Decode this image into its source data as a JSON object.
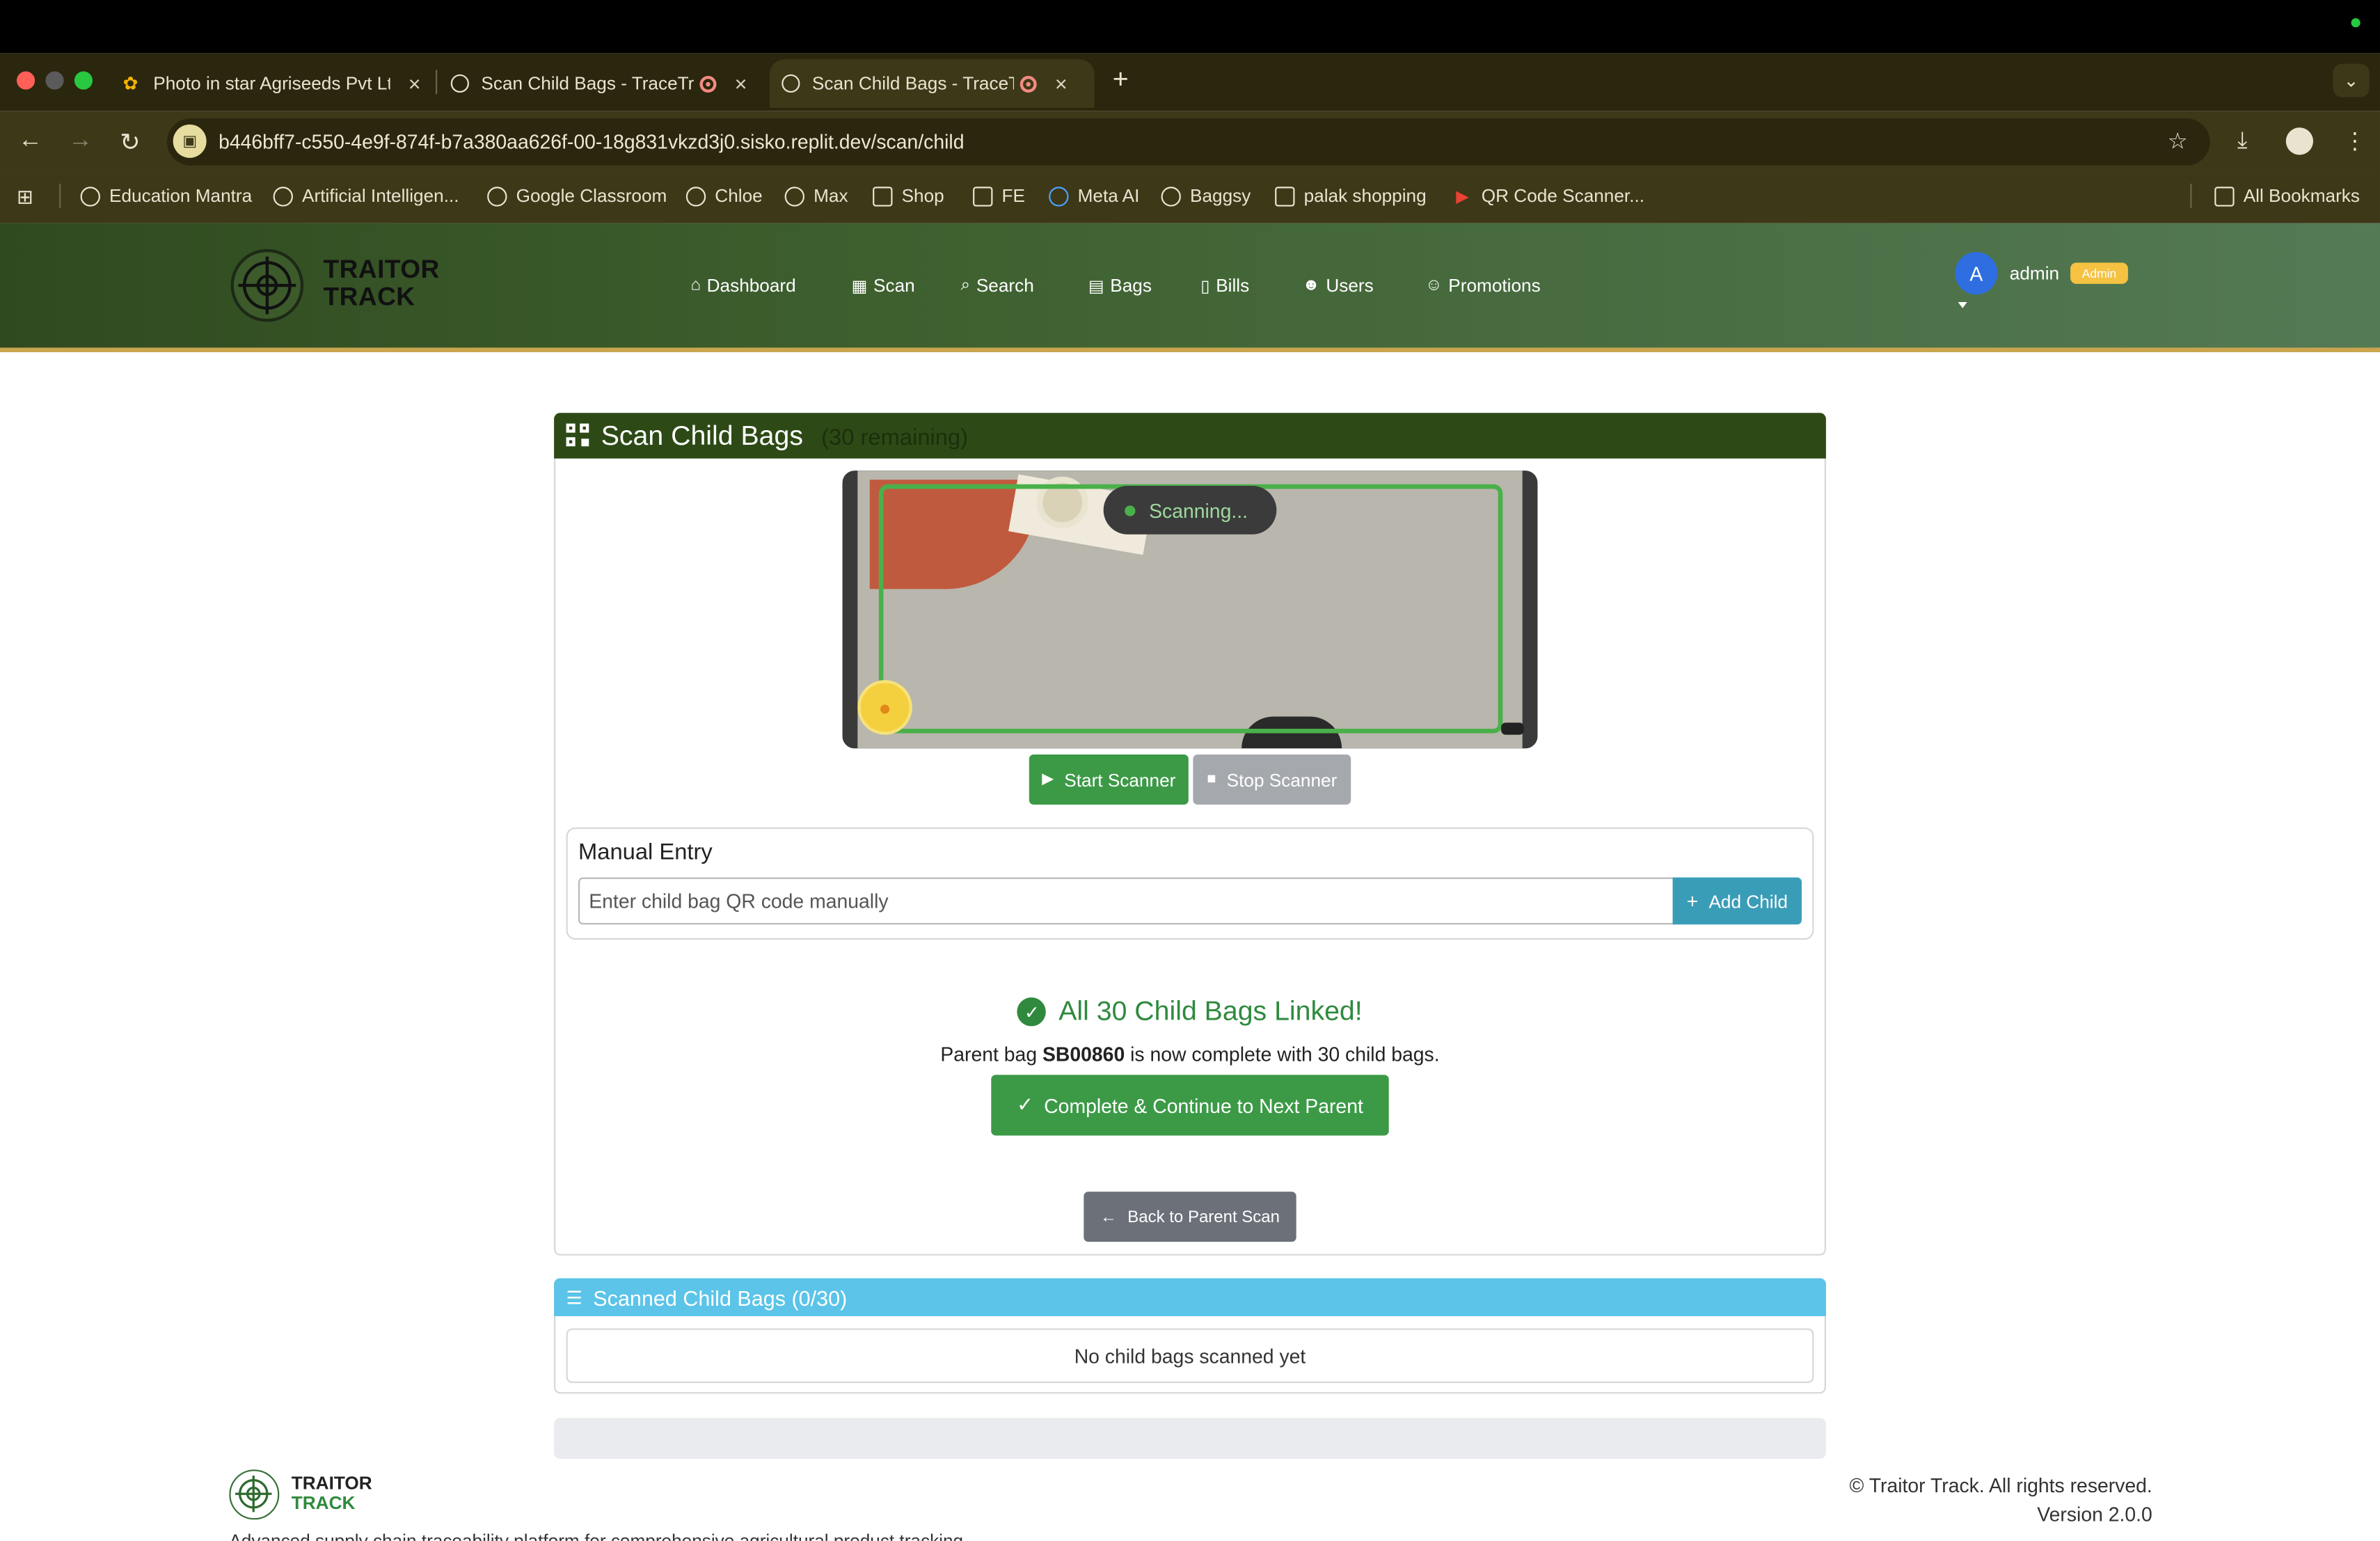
{
  "browser": {
    "tabs": [
      {
        "title": "Photo in star Agriseeds Pvt Ltd",
        "close": "×"
      },
      {
        "title": "Scan Child Bags - TraceTrack",
        "close": "×"
      },
      {
        "title": "Scan Child Bags - TraceTrack",
        "close": "×"
      }
    ],
    "new_tab": "+",
    "url": "b446bff7-c550-4e9f-874f-b7a380aa626f-00-18g831vkzd3j0.sisko.replit.dev/scan/child",
    "bookmarks": [
      "Education Mantra",
      "Artificial Intelligen...",
      "Google Classroom",
      "Chloe",
      "Max",
      "Shop",
      "FE",
      "Meta AI",
      "Baggsy",
      "palak shopping",
      "QR Code Scanner..."
    ],
    "all_bookmarks": "All Bookmarks"
  },
  "app": {
    "logo_line1": "TRAITOR",
    "logo_line2": "TRACK",
    "nav": [
      "Dashboard",
      "Scan",
      "Search",
      "Bags",
      "Bills",
      "Users",
      "Promotions"
    ],
    "user": {
      "initial": "A",
      "name": "admin",
      "badge": "Admin"
    },
    "accent_color": "#3c9a47"
  },
  "scan_card": {
    "title": "Scan Child Bags",
    "remaining": "(30 remaining)",
    "scanning_status": "Scanning...",
    "start_label": "Start Scanner",
    "stop_label": "Stop Scanner",
    "manual_title": "Manual Entry",
    "manual_placeholder": "Enter child bag QR code manually",
    "add_label": "Add Child",
    "success_title": "All 30 Child Bags Linked!",
    "msg_pre": "Parent bag ",
    "parent_id": "SB00860",
    "msg_post": " is now complete with 30 child bags.",
    "complete_label": "Complete & Continue to Next Parent",
    "back_label": "Back to Parent Scan"
  },
  "scanned_card": {
    "title": "Scanned Child Bags (0/30)",
    "empty_text": "No child bags scanned yet"
  },
  "footer": {
    "logo_line1": "TRAITOR",
    "logo_line2": "TRACK",
    "description": "Advanced supply chain traceability platform for comprehensive agricultural product tracking",
    "copyright": "© Traitor Track. All rights reserved.",
    "version": "Version 2.0.0"
  }
}
